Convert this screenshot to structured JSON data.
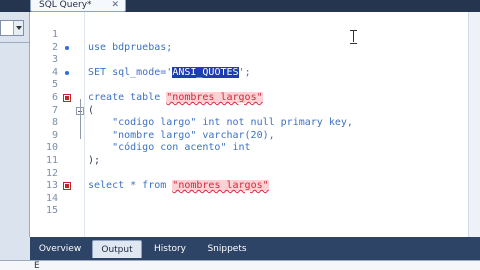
{
  "window": {
    "tab_title": "SQL Query*",
    "tab_close": "✕"
  },
  "editor": {
    "lines": [
      {
        "n": "1",
        "marker": "none",
        "text": ""
      },
      {
        "n": "2",
        "marker": "dot",
        "parts": [
          {
            "t": "use bdpruebas;",
            "c": "kw"
          }
        ]
      },
      {
        "n": "3",
        "marker": "none",
        "text": ""
      },
      {
        "n": "4",
        "marker": "dot",
        "parts": [
          {
            "t": "SET sql_mode=",
            "c": "kw"
          },
          {
            "t": "'",
            "c": "kw"
          },
          {
            "t": "ANSI_QUOTES",
            "c": "hl-sel"
          },
          {
            "t": "';",
            "c": "kw"
          }
        ]
      },
      {
        "n": "5",
        "marker": "none",
        "text": ""
      },
      {
        "n": "6",
        "marker": "err",
        "parts": [
          {
            "t": "create table ",
            "c": "kw"
          },
          {
            "t": "\"nombres largos\"",
            "c": "hl-err"
          }
        ]
      },
      {
        "n": "7",
        "marker": "fold",
        "parts": [
          {
            "t": "(",
            "c": "punc"
          }
        ]
      },
      {
        "n": "8",
        "marker": "none",
        "parts": [
          {
            "t": "    \"codigo largo\" int not null primary key,",
            "c": "kw"
          }
        ]
      },
      {
        "n": "9",
        "marker": "none",
        "parts": [
          {
            "t": "    \"nombre largo\" varchar(20),",
            "c": "kw"
          }
        ]
      },
      {
        "n": "10",
        "marker": "none",
        "parts": [
          {
            "t": "    \"código con acento\" int",
            "c": "kw"
          }
        ]
      },
      {
        "n": "11",
        "marker": "none",
        "parts": [
          {
            "t": ");",
            "c": "punc"
          }
        ]
      },
      {
        "n": "12",
        "marker": "none",
        "text": ""
      },
      {
        "n": "13",
        "marker": "err",
        "parts": [
          {
            "t": "select * from ",
            "c": "kw"
          },
          {
            "t": "\"nombres largos\"",
            "c": "hl-err"
          }
        ]
      },
      {
        "n": "14",
        "marker": "none",
        "text": ""
      },
      {
        "n": "15",
        "marker": "none",
        "text": ""
      }
    ]
  },
  "bottom_tabs": [
    {
      "label": "Overview",
      "active": false
    },
    {
      "label": "Output",
      "active": true
    },
    {
      "label": "History",
      "active": false
    },
    {
      "label": "Snippets",
      "active": false
    }
  ],
  "status_glyph": "E"
}
